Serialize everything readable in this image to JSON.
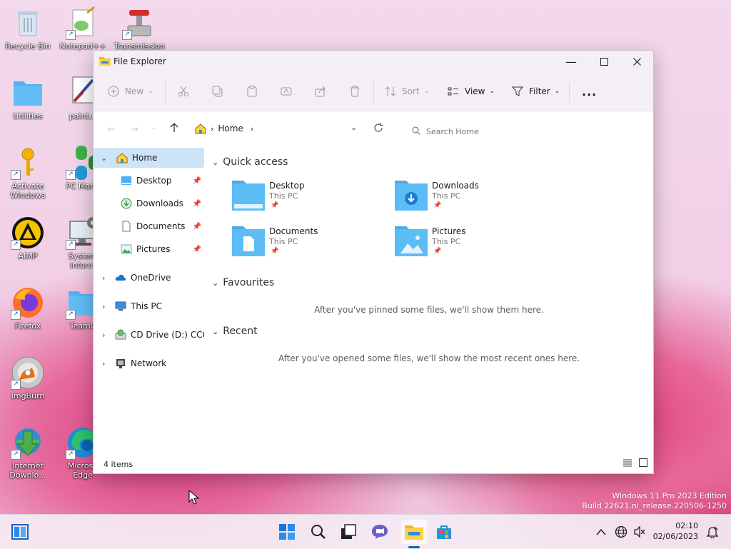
{
  "desktop": {
    "icons": [
      {
        "label": "Recycle Bin"
      },
      {
        "label": "Notepad++"
      },
      {
        "label": "Transmission"
      },
      {
        "label": "Utilities"
      },
      {
        "label": "paint.n"
      },
      {
        "label": "Activate Windows"
      },
      {
        "label": "PC Mana"
      },
      {
        "label": "AIMP"
      },
      {
        "label": "System Inform"
      },
      {
        "label": "Firefox"
      },
      {
        "label": "TeamC"
      },
      {
        "label": "ImgBurn"
      },
      {
        "label": "Internet Downlo..."
      },
      {
        "label": "Microso Edge"
      }
    ],
    "watermark": {
      "line1": "Windows 11 Pro 2023 Edition",
      "line2": "Build 22621.ni_release.220506-1250"
    }
  },
  "window": {
    "title": "File Explorer",
    "toolbar": {
      "new": "New",
      "sort": "Sort",
      "view": "View",
      "filter": "Filter",
      "more": "..."
    },
    "address": {
      "crumb": "Home"
    },
    "search": {
      "placeholder": "Search Home"
    },
    "nav": {
      "home": "Home",
      "quick": [
        {
          "label": "Desktop"
        },
        {
          "label": "Downloads"
        },
        {
          "label": "Documents"
        },
        {
          "label": "Pictures"
        }
      ],
      "onedrive": "OneDrive",
      "thispc": "This PC",
      "cddrive": "CD Drive (D:) CCCOM",
      "network": "Network"
    },
    "main": {
      "quick_access": "Quick access",
      "tiles": [
        {
          "name": "Desktop",
          "sub": "This PC"
        },
        {
          "name": "Downloads",
          "sub": "This PC"
        },
        {
          "name": "Documents",
          "sub": "This PC"
        },
        {
          "name": "Pictures",
          "sub": "This PC"
        }
      ],
      "favourites": "Favourites",
      "favourites_empty": "After you've pinned some files, we'll show them here.",
      "recent": "Recent",
      "recent_empty": "After you've opened some files, we'll show the most recent ones here."
    },
    "status": "4 items"
  },
  "taskbar": {
    "time": "02:10",
    "date": "02/06/2023"
  },
  "colors": {
    "accent": "#0067c0",
    "folder": "#4fb0f0",
    "nav_selected": "#cde3f7"
  }
}
